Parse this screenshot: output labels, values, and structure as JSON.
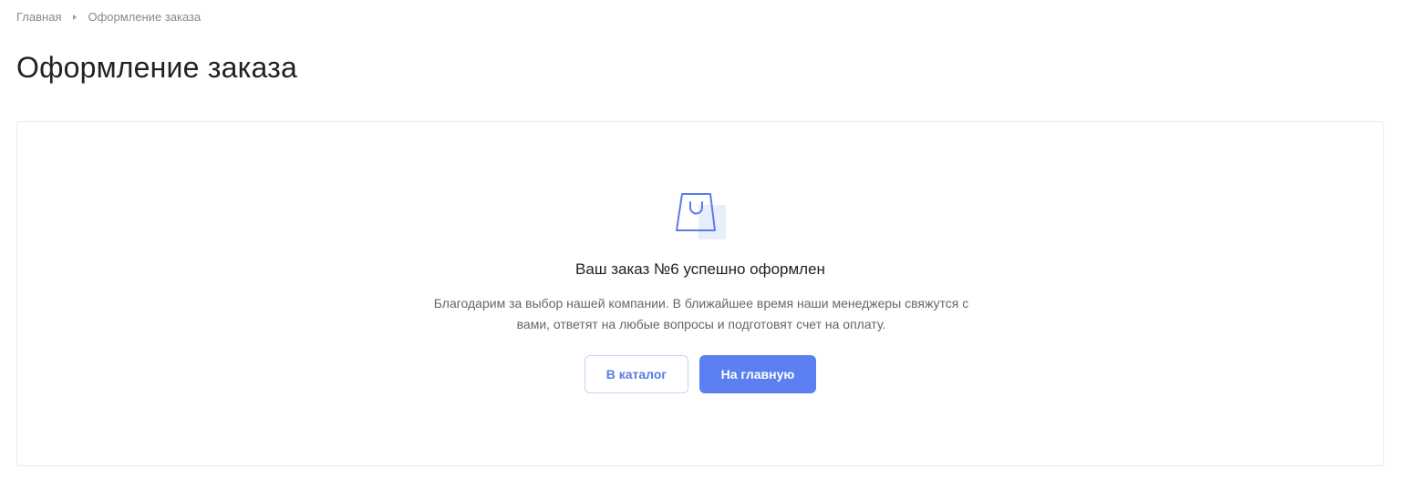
{
  "breadcrumb": {
    "home": "Главная",
    "current": "Оформление заказа"
  },
  "page": {
    "title": "Оформление заказа"
  },
  "success": {
    "icon": "shopping-bag-icon",
    "title": "Ваш заказ №6 успешно оформлен",
    "text": "Благодарим за выбор нашей компании. В ближайшее время наши менеджеры свяжутся с вами, ответят на любые вопросы и подготовят счет на оплату."
  },
  "actions": {
    "catalog_label": "В каталог",
    "home_label": "На главную"
  },
  "colors": {
    "accent": "#5b7ff0",
    "outline_border": "#c7d2f7",
    "icon_fill": "#e9eefc"
  }
}
